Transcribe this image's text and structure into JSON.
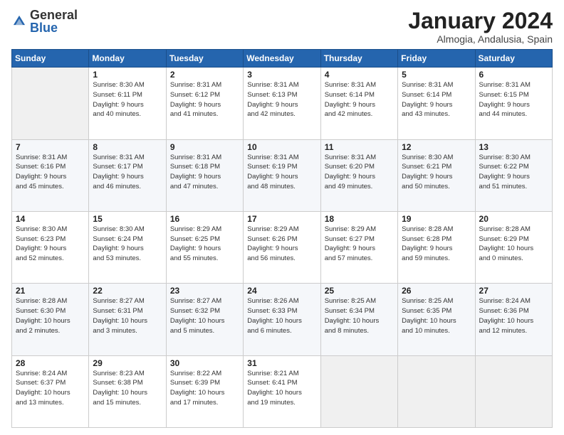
{
  "header": {
    "logo": {
      "general": "General",
      "blue": "Blue"
    },
    "title": "January 2024",
    "location": "Almogia, Andalusia, Spain"
  },
  "days_of_week": [
    "Sunday",
    "Monday",
    "Tuesday",
    "Wednesday",
    "Thursday",
    "Friday",
    "Saturday"
  ],
  "weeks": [
    [
      {
        "day": "",
        "info": ""
      },
      {
        "day": "1",
        "info": "Sunrise: 8:30 AM\nSunset: 6:11 PM\nDaylight: 9 hours\nand 40 minutes."
      },
      {
        "day": "2",
        "info": "Sunrise: 8:31 AM\nSunset: 6:12 PM\nDaylight: 9 hours\nand 41 minutes."
      },
      {
        "day": "3",
        "info": "Sunrise: 8:31 AM\nSunset: 6:13 PM\nDaylight: 9 hours\nand 42 minutes."
      },
      {
        "day": "4",
        "info": "Sunrise: 8:31 AM\nSunset: 6:14 PM\nDaylight: 9 hours\nand 42 minutes."
      },
      {
        "day": "5",
        "info": "Sunrise: 8:31 AM\nSunset: 6:14 PM\nDaylight: 9 hours\nand 43 minutes."
      },
      {
        "day": "6",
        "info": "Sunrise: 8:31 AM\nSunset: 6:15 PM\nDaylight: 9 hours\nand 44 minutes."
      }
    ],
    [
      {
        "day": "7",
        "info": "Sunrise: 8:31 AM\nSunset: 6:16 PM\nDaylight: 9 hours\nand 45 minutes."
      },
      {
        "day": "8",
        "info": "Sunrise: 8:31 AM\nSunset: 6:17 PM\nDaylight: 9 hours\nand 46 minutes."
      },
      {
        "day": "9",
        "info": "Sunrise: 8:31 AM\nSunset: 6:18 PM\nDaylight: 9 hours\nand 47 minutes."
      },
      {
        "day": "10",
        "info": "Sunrise: 8:31 AM\nSunset: 6:19 PM\nDaylight: 9 hours\nand 48 minutes."
      },
      {
        "day": "11",
        "info": "Sunrise: 8:31 AM\nSunset: 6:20 PM\nDaylight: 9 hours\nand 49 minutes."
      },
      {
        "day": "12",
        "info": "Sunrise: 8:30 AM\nSunset: 6:21 PM\nDaylight: 9 hours\nand 50 minutes."
      },
      {
        "day": "13",
        "info": "Sunrise: 8:30 AM\nSunset: 6:22 PM\nDaylight: 9 hours\nand 51 minutes."
      }
    ],
    [
      {
        "day": "14",
        "info": "Sunrise: 8:30 AM\nSunset: 6:23 PM\nDaylight: 9 hours\nand 52 minutes."
      },
      {
        "day": "15",
        "info": "Sunrise: 8:30 AM\nSunset: 6:24 PM\nDaylight: 9 hours\nand 53 minutes."
      },
      {
        "day": "16",
        "info": "Sunrise: 8:29 AM\nSunset: 6:25 PM\nDaylight: 9 hours\nand 55 minutes."
      },
      {
        "day": "17",
        "info": "Sunrise: 8:29 AM\nSunset: 6:26 PM\nDaylight: 9 hours\nand 56 minutes."
      },
      {
        "day": "18",
        "info": "Sunrise: 8:29 AM\nSunset: 6:27 PM\nDaylight: 9 hours\nand 57 minutes."
      },
      {
        "day": "19",
        "info": "Sunrise: 8:28 AM\nSunset: 6:28 PM\nDaylight: 9 hours\nand 59 minutes."
      },
      {
        "day": "20",
        "info": "Sunrise: 8:28 AM\nSunset: 6:29 PM\nDaylight: 10 hours\nand 0 minutes."
      }
    ],
    [
      {
        "day": "21",
        "info": "Sunrise: 8:28 AM\nSunset: 6:30 PM\nDaylight: 10 hours\nand 2 minutes."
      },
      {
        "day": "22",
        "info": "Sunrise: 8:27 AM\nSunset: 6:31 PM\nDaylight: 10 hours\nand 3 minutes."
      },
      {
        "day": "23",
        "info": "Sunrise: 8:27 AM\nSunset: 6:32 PM\nDaylight: 10 hours\nand 5 minutes."
      },
      {
        "day": "24",
        "info": "Sunrise: 8:26 AM\nSunset: 6:33 PM\nDaylight: 10 hours\nand 6 minutes."
      },
      {
        "day": "25",
        "info": "Sunrise: 8:25 AM\nSunset: 6:34 PM\nDaylight: 10 hours\nand 8 minutes."
      },
      {
        "day": "26",
        "info": "Sunrise: 8:25 AM\nSunset: 6:35 PM\nDaylight: 10 hours\nand 10 minutes."
      },
      {
        "day": "27",
        "info": "Sunrise: 8:24 AM\nSunset: 6:36 PM\nDaylight: 10 hours\nand 12 minutes."
      }
    ],
    [
      {
        "day": "28",
        "info": "Sunrise: 8:24 AM\nSunset: 6:37 PM\nDaylight: 10 hours\nand 13 minutes."
      },
      {
        "day": "29",
        "info": "Sunrise: 8:23 AM\nSunset: 6:38 PM\nDaylight: 10 hours\nand 15 minutes."
      },
      {
        "day": "30",
        "info": "Sunrise: 8:22 AM\nSunset: 6:39 PM\nDaylight: 10 hours\nand 17 minutes."
      },
      {
        "day": "31",
        "info": "Sunrise: 8:21 AM\nSunset: 6:41 PM\nDaylight: 10 hours\nand 19 minutes."
      },
      {
        "day": "",
        "info": ""
      },
      {
        "day": "",
        "info": ""
      },
      {
        "day": "",
        "info": ""
      }
    ]
  ]
}
